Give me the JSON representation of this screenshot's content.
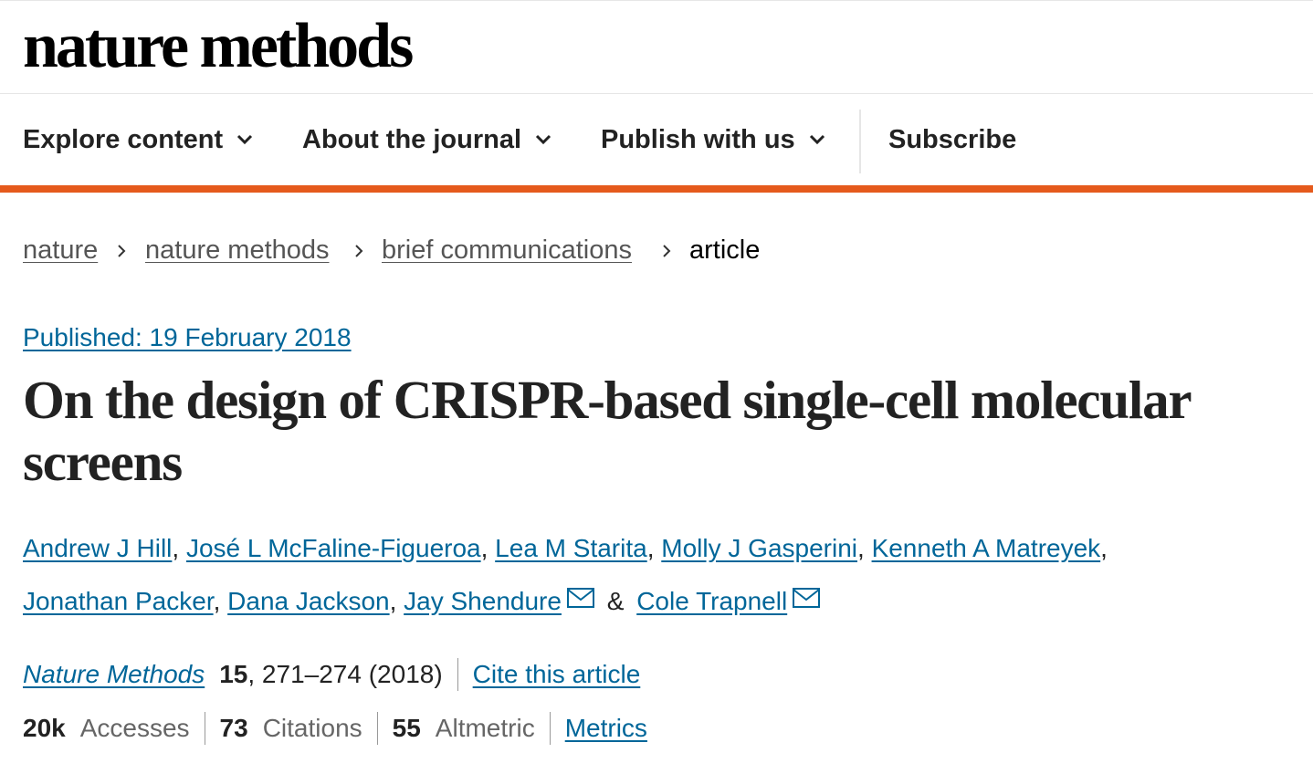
{
  "brand": {
    "logo_text": "nature methods"
  },
  "nav": {
    "explore": "Explore content",
    "about": "About the journal",
    "publish": "Publish with us",
    "subscribe": "Subscribe"
  },
  "breadcrumb": {
    "items": [
      "nature",
      "nature methods",
      "brief communications"
    ],
    "current": "article"
  },
  "article": {
    "published": "Published: 19 February 2018",
    "title": "On the design of CRISPR-based single-cell molecular screens",
    "authors": [
      "Andrew J Hill",
      "José L McFaline-Figueroa",
      "Lea M Starita",
      "Molly J Gasperini",
      "Kenneth A Matreyek",
      "Jonathan Packer",
      "Dana Jackson",
      "Jay Shendure",
      "Cole Trapnell"
    ],
    "author_sep": ", ",
    "author_last_sep": "&",
    "journal": "Nature Methods",
    "volume": "15",
    "pages_year": ", 271–274 (2018)",
    "cite_label": "Cite this article"
  },
  "metrics": {
    "accesses_value": "20k",
    "accesses_label": "Accesses",
    "citations_value": "73",
    "citations_label": "Citations",
    "altmetric_value": "55",
    "altmetric_label": "Altmetric",
    "metrics_link": "Metrics"
  },
  "colors": {
    "accent": "#e55a1c",
    "link": "#006699",
    "text": "#222222"
  },
  "icons": {
    "nav_dropdown": "chevron-down-icon",
    "breadcrumb_sep": "chevron-right-icon",
    "contact": "mail-icon"
  }
}
